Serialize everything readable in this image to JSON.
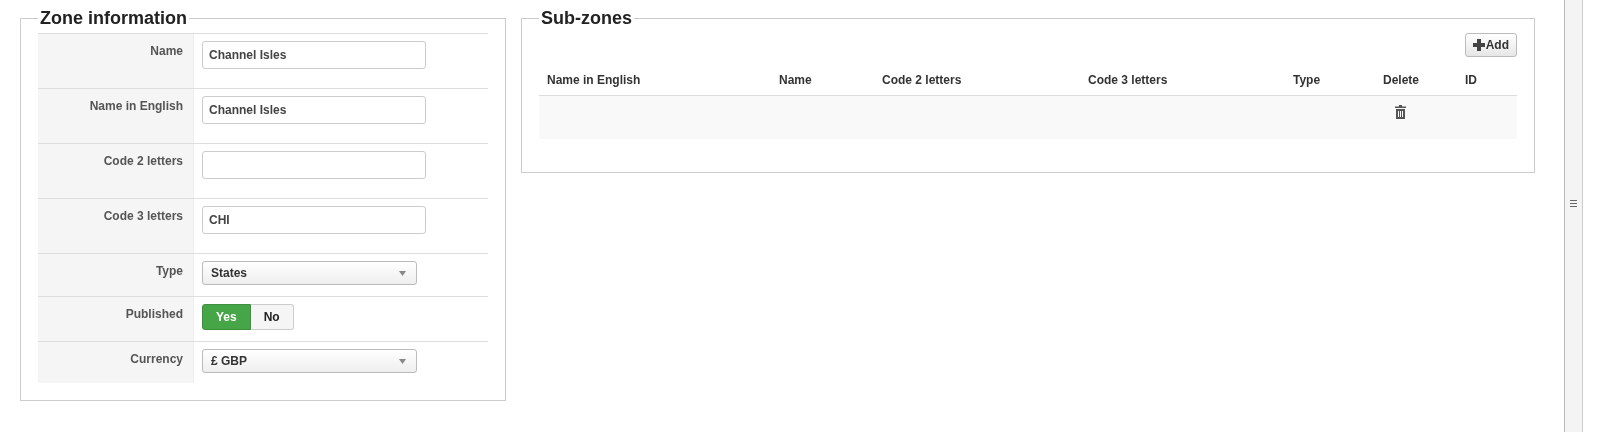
{
  "zone_information": {
    "title": "Zone information",
    "fields": [
      {
        "kind": "text",
        "label": "Name",
        "value": "Channel Isles"
      },
      {
        "kind": "text",
        "label": "Name in English",
        "value": "Channel Isles"
      },
      {
        "kind": "text",
        "label": "Code 2 letters"
      },
      {
        "kind": "text",
        "label": "Code 3 letters",
        "value": "CHI"
      },
      {
        "kind": "select",
        "label": "Type",
        "value": "States"
      },
      {
        "kind": "toggle",
        "label": "Published",
        "options": [
          {
            "label": "Yes",
            "selected": true
          },
          {
            "label": "No",
            "selected": false
          }
        ]
      },
      {
        "kind": "select",
        "label": "Currency",
        "value": "£ GBP"
      }
    ]
  },
  "sub_zones": {
    "title": "Sub-zones",
    "add_button": "Add",
    "table": {
      "columns": [
        "Name in English",
        "Name",
        "Code 2 letters",
        "Code 3 letters",
        "Type",
        "Delete",
        "ID"
      ],
      "rows": [
        {
          "delete": true
        }
      ]
    }
  }
}
